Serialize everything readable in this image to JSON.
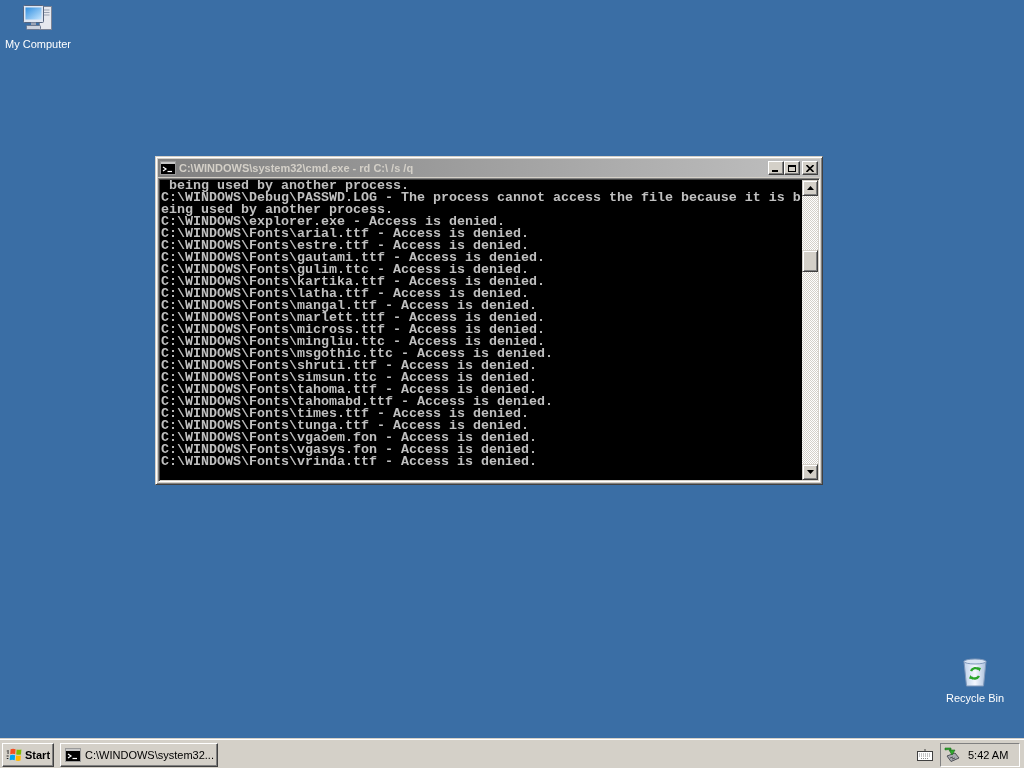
{
  "desktop_icons": [
    {
      "kind": "computer",
      "label": "My Computer"
    },
    {
      "kind": "recycle-bin",
      "label": "Recycle Bin"
    }
  ],
  "console_window": {
    "title": "C:\\WINDOWS\\system32\\cmd.exe - rd C:\\ /s /q",
    "active": false,
    "lines": [
      " being used by another process.",
      "C:\\WINDOWS\\Debug\\PASSWD.LOG - The process cannot access the file because it is b",
      "eing used by another process.",
      "C:\\WINDOWS\\explorer.exe - Access is denied.",
      "C:\\WINDOWS\\Fonts\\arial.ttf - Access is denied.",
      "C:\\WINDOWS\\Fonts\\estre.ttf - Access is denied.",
      "C:\\WINDOWS\\Fonts\\gautami.ttf - Access is denied.",
      "C:\\WINDOWS\\Fonts\\gulim.ttc - Access is denied.",
      "C:\\WINDOWS\\Fonts\\kartika.ttf - Access is denied.",
      "C:\\WINDOWS\\Fonts\\latha.ttf - Access is denied.",
      "C:\\WINDOWS\\Fonts\\mangal.ttf - Access is denied.",
      "C:\\WINDOWS\\Fonts\\marlett.ttf - Access is denied.",
      "C:\\WINDOWS\\Fonts\\micross.ttf - Access is denied.",
      "C:\\WINDOWS\\Fonts\\mingliu.ttc - Access is denied.",
      "C:\\WINDOWS\\Fonts\\msgothic.ttc - Access is denied.",
      "C:\\WINDOWS\\Fonts\\shruti.ttf - Access is denied.",
      "C:\\WINDOWS\\Fonts\\simsun.ttc - Access is denied.",
      "C:\\WINDOWS\\Fonts\\tahoma.ttf - Access is denied.",
      "C:\\WINDOWS\\Fonts\\tahomabd.ttf - Access is denied.",
      "C:\\WINDOWS\\Fonts\\times.ttf - Access is denied.",
      "C:\\WINDOWS\\Fonts\\tunga.ttf - Access is denied.",
      "C:\\WINDOWS\\Fonts\\vgaoem.fon - Access is denied.",
      "C:\\WINDOWS\\Fonts\\vgasys.fon - Access is denied.",
      "C:\\WINDOWS\\Fonts\\vrinda.ttf - Access is denied."
    ]
  },
  "taskbar": {
    "start": "Start",
    "tasks": [
      {
        "label": "C:\\WINDOWS\\system32...",
        "selected": false
      }
    ],
    "clock": "5:42 AM"
  }
}
